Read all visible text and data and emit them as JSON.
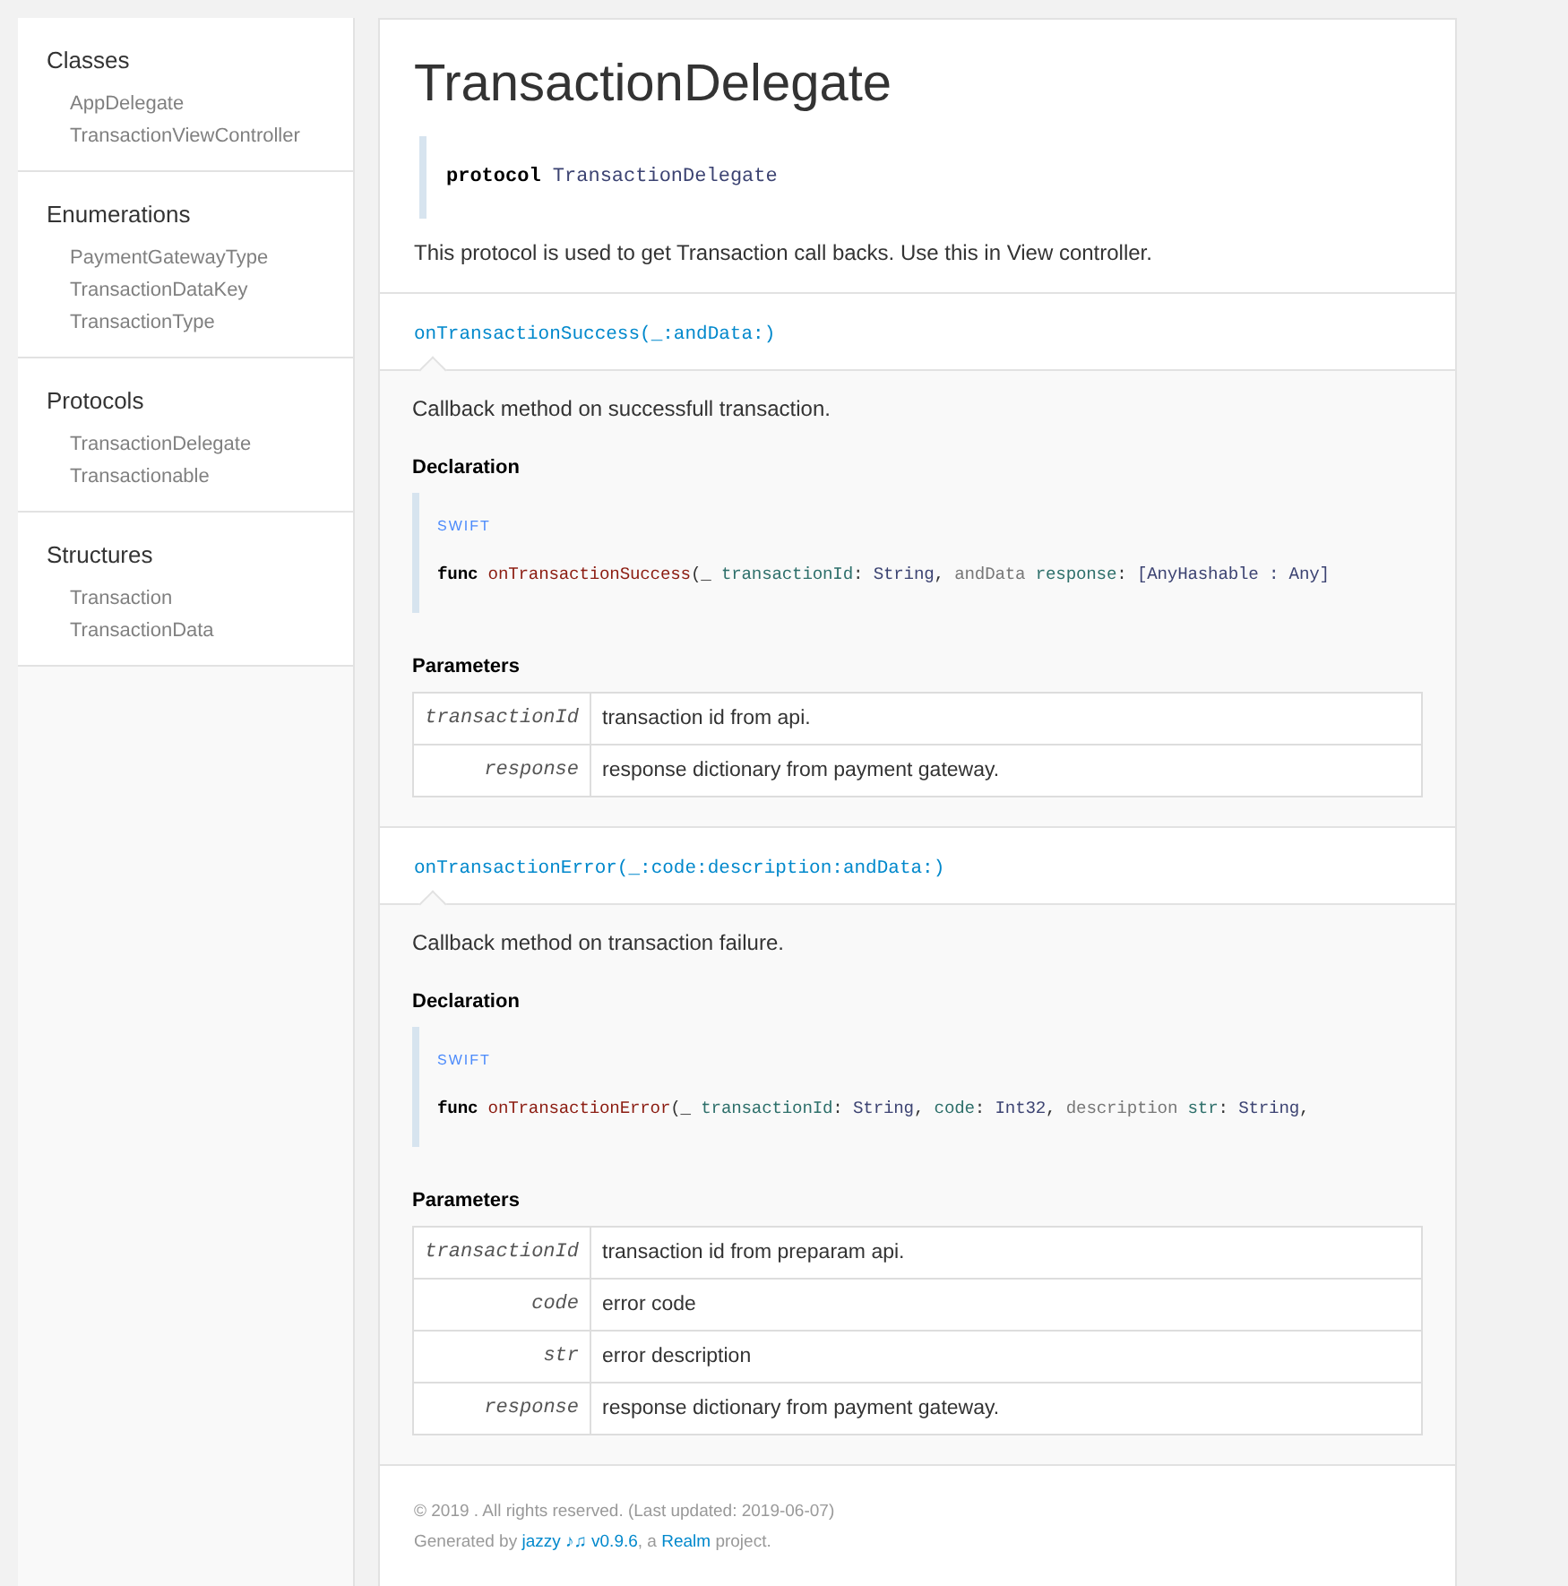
{
  "sidebar": {
    "sections": [
      {
        "title": "Classes",
        "items": [
          "AppDelegate",
          "TransactionViewController"
        ]
      },
      {
        "title": "Enumerations",
        "items": [
          "PaymentGatewayType",
          "TransactionDataKey",
          "TransactionType"
        ]
      },
      {
        "title": "Protocols",
        "items": [
          "TransactionDelegate",
          "Transactionable"
        ]
      },
      {
        "title": "Structures",
        "items": [
          "Transaction",
          "TransactionData"
        ]
      }
    ]
  },
  "main": {
    "title": "TransactionDelegate",
    "declaration": [
      {
        "kind": "keyword",
        "text": "protocol "
      },
      {
        "kind": "type",
        "text": "TransactionDelegate"
      }
    ],
    "abstract": "This protocol is used to get Transaction call backs. Use this in View controller.",
    "methods": [
      {
        "name": "onTransactionSuccess(_:andData:)",
        "abstract": "Callback method on successfull transaction.",
        "declaration_heading": "Declaration",
        "language": "SWIFT",
        "code": [
          {
            "kind": "keyword",
            "text": "func "
          },
          {
            "kind": "function",
            "text": "onTransactionSuccess"
          },
          {
            "kind": "plain",
            "text": "(_ "
          },
          {
            "kind": "param",
            "text": "transactionId"
          },
          {
            "kind": "plain",
            "text": ": "
          },
          {
            "kind": "type",
            "text": "String"
          },
          {
            "kind": "plain",
            "text": ", "
          },
          {
            "kind": "label",
            "text": "andData "
          },
          {
            "kind": "param",
            "text": "response"
          },
          {
            "kind": "plain",
            "text": ": "
          },
          {
            "kind": "type",
            "text": "[AnyHashable : Any]"
          }
        ],
        "parameters_heading": "Parameters",
        "parameters": [
          {
            "name": "transactionId",
            "description": "transaction id from api."
          },
          {
            "name": "response",
            "description": "response dictionary from payment gateway."
          }
        ]
      },
      {
        "name": "onTransactionError(_:code:description:andData:)",
        "abstract": "Callback method on transaction failure.",
        "declaration_heading": "Declaration",
        "language": "SWIFT",
        "code": [
          {
            "kind": "keyword",
            "text": "func "
          },
          {
            "kind": "function",
            "text": "onTransactionError"
          },
          {
            "kind": "plain",
            "text": "(_ "
          },
          {
            "kind": "param",
            "text": "transactionId"
          },
          {
            "kind": "plain",
            "text": ": "
          },
          {
            "kind": "type",
            "text": "String"
          },
          {
            "kind": "plain",
            "text": ", "
          },
          {
            "kind": "param",
            "text": "code"
          },
          {
            "kind": "plain",
            "text": ": "
          },
          {
            "kind": "type",
            "text": "Int32"
          },
          {
            "kind": "plain",
            "text": ", "
          },
          {
            "kind": "label",
            "text": "description "
          },
          {
            "kind": "param",
            "text": "str"
          },
          {
            "kind": "plain",
            "text": ": "
          },
          {
            "kind": "type",
            "text": "String"
          },
          {
            "kind": "plain",
            "text": ","
          }
        ],
        "parameters_heading": "Parameters",
        "parameters": [
          {
            "name": "transactionId",
            "description": "transaction id from preparam api."
          },
          {
            "name": "code",
            "description": "error code"
          },
          {
            "name": "str",
            "description": "error description"
          },
          {
            "name": "response",
            "description": "response dictionary from payment gateway."
          }
        ]
      }
    ]
  },
  "footer": {
    "copyright": "© 2019 . All rights reserved. (Last updated: 2019-06-07)",
    "generated": [
      {
        "kind": "text",
        "text": "Generated by "
      },
      {
        "kind": "link",
        "text": "jazzy ♪♫ v0.9.6"
      },
      {
        "kind": "text",
        "text": ", a "
      },
      {
        "kind": "link",
        "text": "Realm"
      },
      {
        "kind": "text",
        "text": " project."
      }
    ]
  }
}
